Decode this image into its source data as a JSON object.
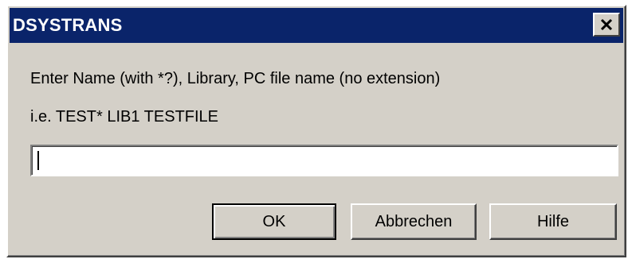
{
  "window": {
    "title": "DSYSTRANS",
    "close_icon": "close-icon"
  },
  "dialog": {
    "prompt_line_1": "Enter Name (with *?), Library, PC file name (no extension)",
    "prompt_line_2": "i.e. TEST* LIB1 TESTFILE",
    "input_value": "",
    "input_placeholder": ""
  },
  "buttons": {
    "ok_label": "OK",
    "cancel_label": "Abbrechen",
    "help_label": "Hilfe"
  },
  "colors": {
    "titlebar": "#0a246a",
    "face": "#d4d0c8"
  }
}
